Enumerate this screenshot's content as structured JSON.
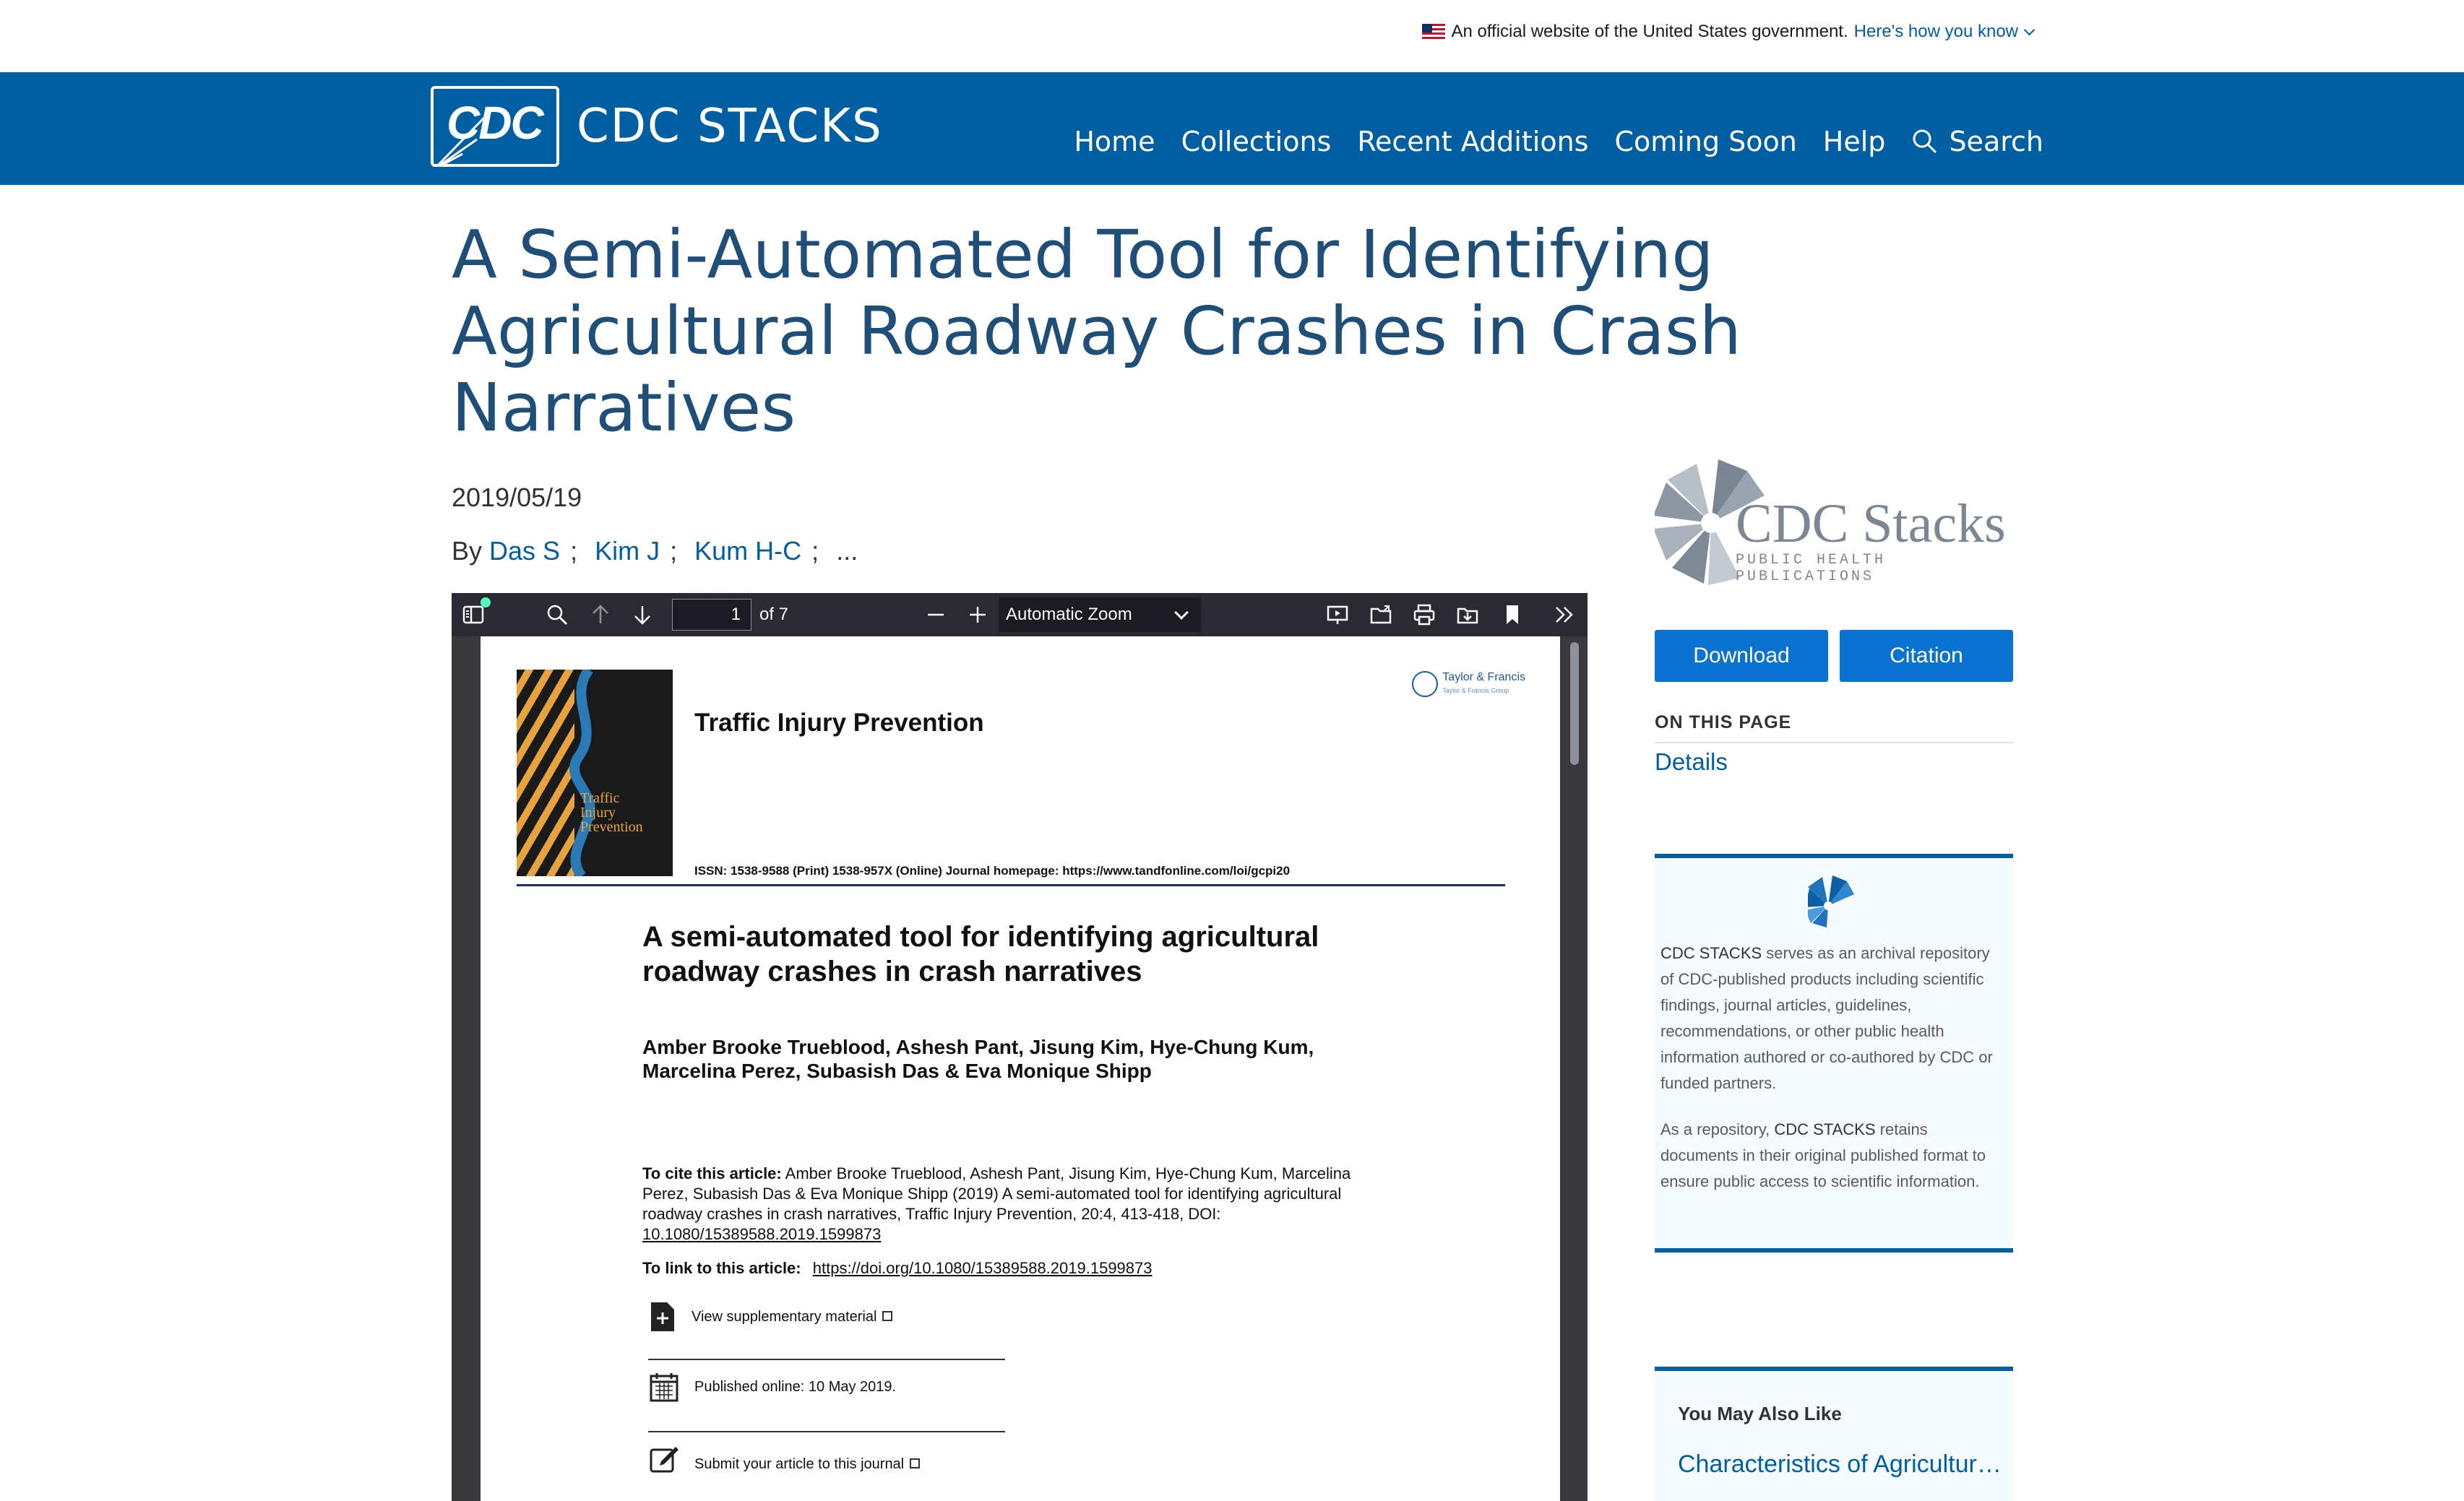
{
  "gov_banner": {
    "text": "An official website of the United States government.",
    "link": "Here's how you know"
  },
  "header": {
    "logo_text": "CDC",
    "site_title": "CDC STACKS",
    "nav": [
      "Home",
      "Collections",
      "Recent Additions",
      "Coming Soon",
      "Help"
    ],
    "search_label": "Search"
  },
  "article": {
    "title": "A Semi-Automated Tool for Identifying Agricultural Roadway Crashes in Crash Narratives",
    "date": "2019/05/19",
    "by_label": "By",
    "authors": [
      "Das S",
      "Kim J",
      "Kum H-C"
    ],
    "more": "..."
  },
  "viewer": {
    "page_current": "1",
    "page_of": "of 7",
    "zoom": "Automatic Zoom"
  },
  "pdf": {
    "journal": "Traffic Injury Prevention",
    "cover_text": [
      "Traffic",
      "Injury",
      "Prevention"
    ],
    "publisher": "Taylor & Francis",
    "publisher_sub": "Taylor & Francis Group",
    "issn": "ISSN: 1538-9588 (Print) 1538-957X (Online) Journal homepage: https://www.tandfonline.com/loi/gcpi20",
    "title": "A semi-automated tool for identifying agricultural roadway crashes in crash narratives",
    "authors": "Amber Brooke Trueblood, Ashesh Pant, Jisung Kim, Hye-Chung Kum, Marcelina Perez, Subasish Das & Eva Monique Shipp",
    "cite_label": "To cite this article:",
    "cite_text": "Amber Brooke Trueblood, Ashesh Pant, Jisung Kim, Hye-Chung Kum, Marcelina Perez, Subasish Das & Eva Monique Shipp (2019) A semi-automated tool for identifying agricultural roadway crashes in crash narratives, Traffic Injury Prevention, 20:4, 413-418, DOI:",
    "cite_doi": "10.1080/15389588.2019.1599873",
    "link_label": "To link to this article:",
    "link_url": "https://doi.org/10.1080/15389588.2019.1599873",
    "supp": "View supplementary material",
    "published": "Published online: 10 May 2019.",
    "submit": "Submit your article to this journal"
  },
  "sidebar": {
    "logo_main": "CDC Stacks",
    "logo_sub": "PUBLIC HEALTH PUBLICATIONS",
    "download": "Download",
    "citation": "Citation",
    "on_this_page": "ON THIS PAGE",
    "details": "Details",
    "info_brand": "CDC STACKS",
    "info_p1": "serves as an archival repository of CDC-published products including scientific findings, journal articles, guidelines, recommendations, or other public health information authored or co-authored by CDC or funded partners.",
    "info_p2a": "As a repository,",
    "info_p2b": "retains documents in their original published format to ensure public access to scientific information.",
    "also_title": "You May Also Like",
    "also_link": "Characteristics of Agricultural Roadway Crashes"
  },
  "colors": {
    "header_blue": "#005ea2",
    "title_blue": "#1f4e79",
    "button_blue": "#0a72d1",
    "viewer_toolbar": "#2b2a33"
  }
}
